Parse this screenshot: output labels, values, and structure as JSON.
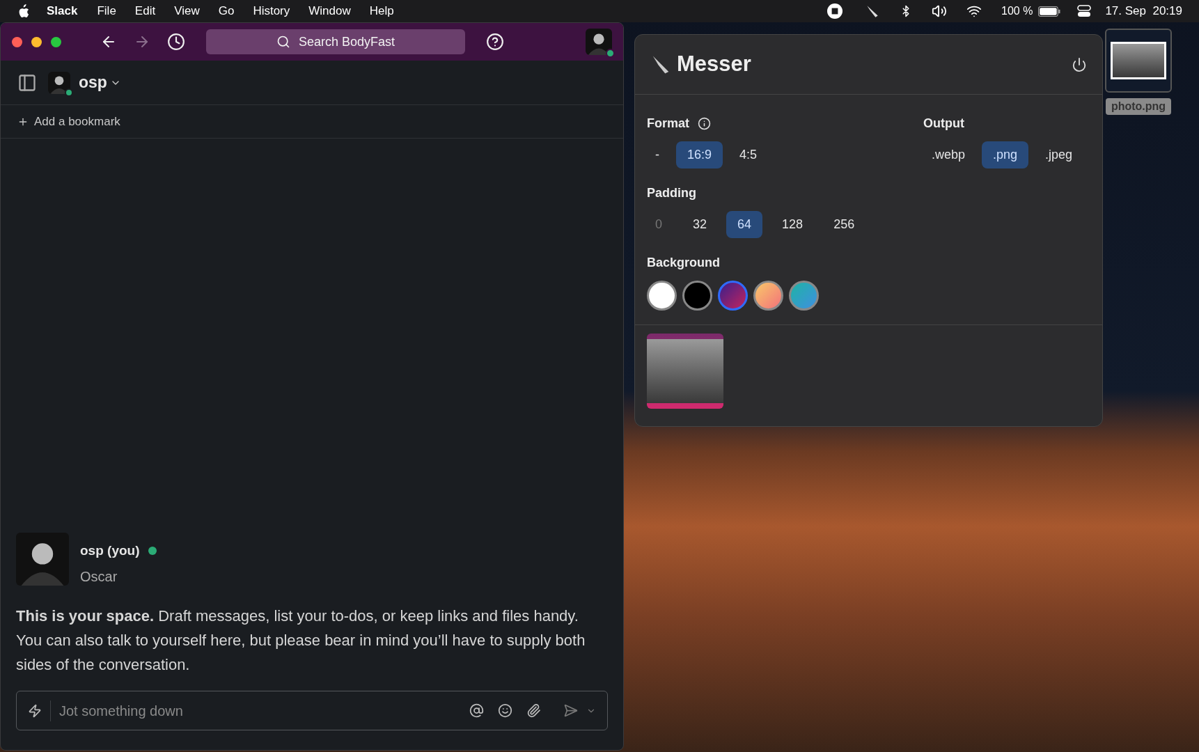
{
  "menu_bar": {
    "app": "Slack",
    "menus": [
      "File",
      "Edit",
      "View",
      "Go",
      "History",
      "Window",
      "Help"
    ],
    "battery": "100 %",
    "clock": "17. Sep  20:19"
  },
  "slack": {
    "search": {
      "placeholder": "Search BodyFast"
    },
    "workspace": "osp",
    "bookmark": "Add a bookmark",
    "profile": {
      "name": "osp (you)",
      "online": true,
      "full_name": "Oscar"
    },
    "intro": "**This is your space.** Draft messages, list your to-dos, or keep links and files handy. You can also talk to yourself here, but please bear in mind you’ll have to supply both sides of the conversation.",
    "composer": {
      "placeholder": "Jot something down"
    }
  },
  "messer": {
    "title": "Messer",
    "format": {
      "label": "Format",
      "options": [
        {
          "label": "-",
          "selected": false
        },
        {
          "label": "16:9",
          "selected": true
        },
        {
          "label": "4:5",
          "selected": false
        }
      ]
    },
    "output": {
      "label": "Output",
      "options": [
        {
          "label": ".webp",
          "selected": false
        },
        {
          "label": ".png",
          "selected": true
        },
        {
          "label": ".jpeg",
          "selected": false
        }
      ]
    },
    "padding": {
      "label": "Padding",
      "options": [
        {
          "label": "0",
          "selected": false,
          "disabled": true
        },
        {
          "label": "32",
          "selected": false,
          "disabled": false
        },
        {
          "label": "64",
          "selected": true,
          "disabled": false
        },
        {
          "label": "128",
          "selected": false,
          "disabled": false
        },
        {
          "label": "256",
          "selected": false,
          "disabled": false
        }
      ]
    },
    "background": {
      "label": "Background",
      "swatches": [
        {
          "kind": "white",
          "selected": false
        },
        {
          "kind": "black",
          "selected": false
        },
        {
          "kind": "violet",
          "selected": true
        },
        {
          "kind": "peach",
          "selected": false
        },
        {
          "kind": "ocean",
          "selected": false
        }
      ]
    }
  },
  "desktop_file": {
    "name": "photo.png"
  }
}
